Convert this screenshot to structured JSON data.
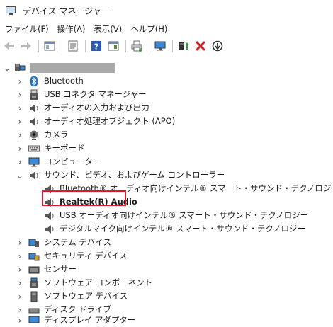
{
  "window": {
    "title": "デバイス マネージャー"
  },
  "menu": [
    {
      "label": "ファイル(F)"
    },
    {
      "label": "操作(A)"
    },
    {
      "label": "表示(V)"
    },
    {
      "label": "ヘルプ(H)"
    }
  ],
  "toolbar": [
    {
      "name": "back-icon"
    },
    {
      "name": "forward-icon"
    },
    {
      "name": "show-hide-console-tree-icon"
    },
    {
      "name": "properties-icon"
    },
    {
      "name": "help-icon"
    },
    {
      "name": "action-pane-icon"
    },
    {
      "name": "print-icon"
    },
    {
      "name": "monitor-icon"
    },
    {
      "name": "update-driver-icon"
    },
    {
      "name": "uninstall-device-icon"
    },
    {
      "name": "enable-device-icon"
    }
  ],
  "tree": {
    "root": {
      "label": ""
    },
    "categories": [
      {
        "label": "Bluetooth",
        "icon": "bluetooth-icon"
      },
      {
        "label": "USB コネクタ マネージャー",
        "icon": "usb-connector-icon"
      },
      {
        "label": "オーディオの入力および出力",
        "icon": "speaker-icon"
      },
      {
        "label": "オーディオ処理オブジェクト (APO)",
        "icon": "speaker-icon"
      },
      {
        "label": "カメラ",
        "icon": "camera-icon"
      },
      {
        "label": "キーボード",
        "icon": "keyboard-icon"
      },
      {
        "label": "コンピューター",
        "icon": "computer-icon"
      },
      {
        "label": "サウンド、ビデオ、およびゲーム コントローラー",
        "icon": "speaker-icon",
        "expanded": true,
        "children": [
          {
            "label": "Bluetooth® オーディオ向けインテル® スマート・サウンド・テクノロジー"
          },
          {
            "label": "Realtek(R) Audio",
            "highlighted": true
          },
          {
            "label": "USB オーディオ向けインテル® スマート・サウンド・テクノロジー"
          },
          {
            "label": "デジタルマイク向けインテル® スマート・サウンド・テクノロジー"
          }
        ]
      },
      {
        "label": "システム デバイス",
        "icon": "system-device-icon"
      },
      {
        "label": "セキュリティ デバイス",
        "icon": "security-device-icon"
      },
      {
        "label": "センサー",
        "icon": "sensor-icon"
      },
      {
        "label": "ソフトウェア コンポーネント",
        "icon": "software-component-icon"
      },
      {
        "label": "ソフトウェア デバイス",
        "icon": "software-device-icon"
      },
      {
        "label": "ディスク ドライブ",
        "icon": "disk-drive-icon"
      },
      {
        "label": "ディスプレイ アダプター",
        "icon": "display-adapter-icon"
      }
    ]
  },
  "colors": {
    "accent": "#1a73c8",
    "highlight": "#e0182a",
    "selected_bg": "#cce4f7"
  }
}
